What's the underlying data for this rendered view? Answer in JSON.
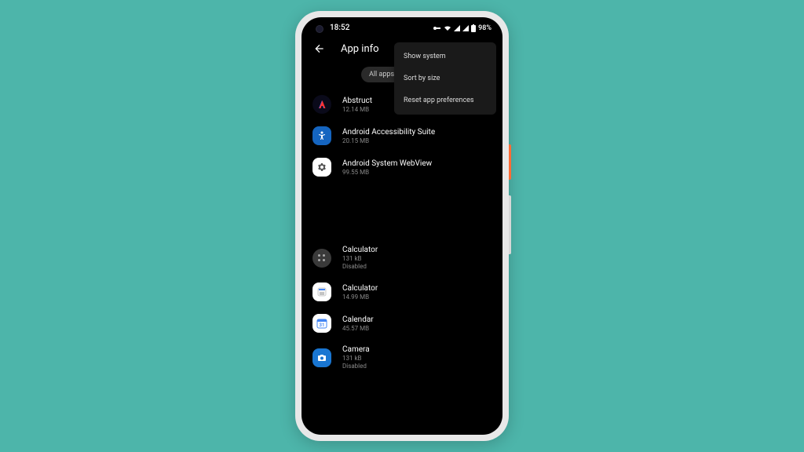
{
  "status": {
    "time": "18:52",
    "battery": "98%"
  },
  "header": {
    "title": "App info"
  },
  "filter": {
    "label": "All apps"
  },
  "menu": {
    "items": [
      "Show system",
      "Sort by size",
      "Reset app preferences"
    ]
  },
  "apps": [
    {
      "name": "Abstruct",
      "size": "12.14 MB",
      "status": ""
    },
    {
      "name": "Android Accessibility Suite",
      "size": "20.15 MB",
      "status": ""
    },
    {
      "name": "Android System WebView",
      "size": "99.55 MB",
      "status": ""
    },
    {
      "name": "Calculator",
      "size": "131 kB",
      "status": "Disabled"
    },
    {
      "name": "Calculator",
      "size": "14.99 MB",
      "status": ""
    },
    {
      "name": "Calendar",
      "size": "45.57 MB",
      "status": ""
    },
    {
      "name": "Camera",
      "size": "131 kB",
      "status": "Disabled"
    }
  ]
}
